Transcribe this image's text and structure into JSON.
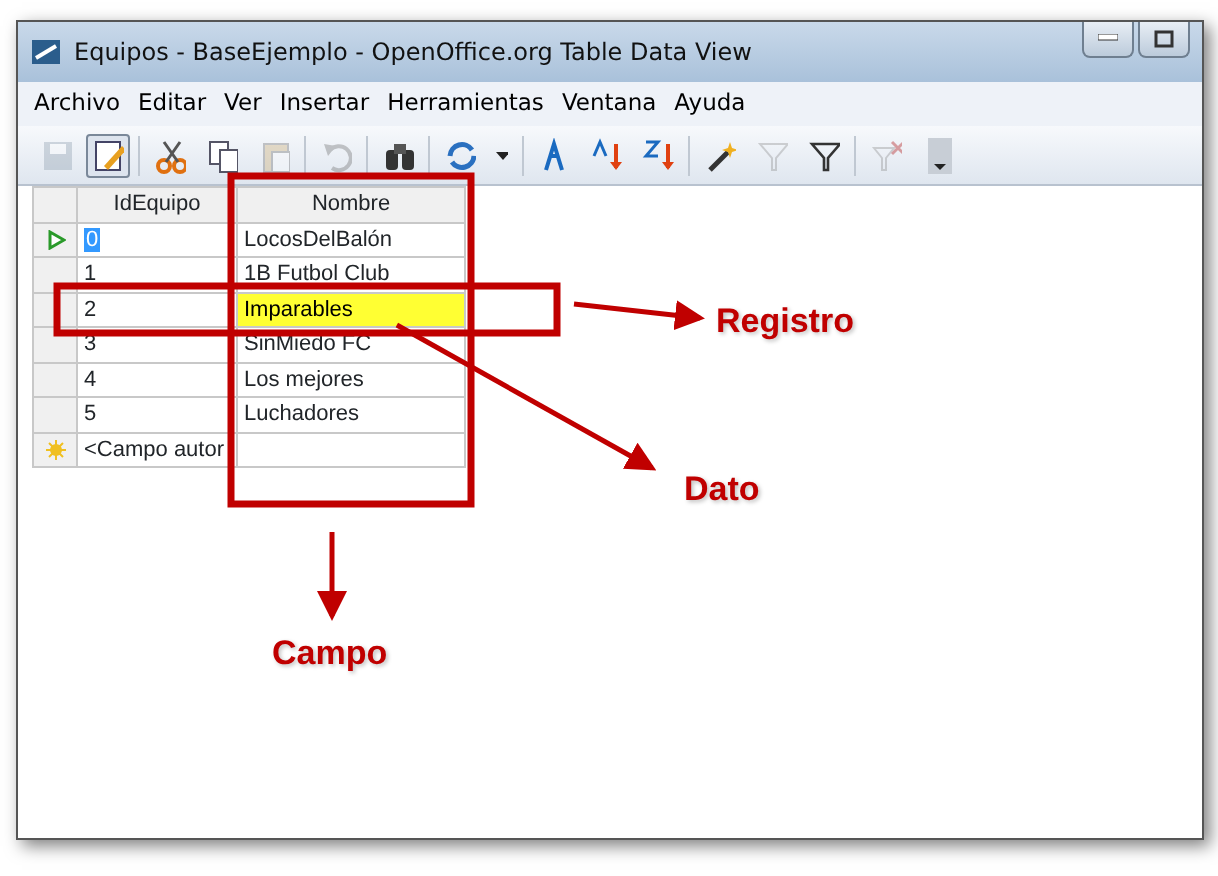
{
  "window": {
    "title": "Equipos - BaseEjemplo - OpenOffice.org Table Data View"
  },
  "menu": [
    "Archivo",
    "Editar",
    "Ver",
    "Insertar",
    "Herramientas",
    "Ventana",
    "Ayuda"
  ],
  "toolbar": [
    {
      "kind": "save",
      "disabled": true
    },
    {
      "kind": "edit",
      "disabled": false,
      "pressed": true
    },
    {
      "kind": "sep"
    },
    {
      "kind": "cut",
      "disabled": false
    },
    {
      "kind": "copy",
      "disabled": false
    },
    {
      "kind": "paste",
      "disabled": true
    },
    {
      "kind": "sep"
    },
    {
      "kind": "undo",
      "disabled": true
    },
    {
      "kind": "sep"
    },
    {
      "kind": "find",
      "disabled": false
    },
    {
      "kind": "sep"
    },
    {
      "kind": "refresh",
      "disabled": false
    },
    {
      "kind": "dropdown",
      "disabled": false
    },
    {
      "kind": "sep"
    },
    {
      "kind": "sort-az",
      "disabled": false
    },
    {
      "kind": "sort-asc",
      "disabled": false
    },
    {
      "kind": "sort-desc",
      "disabled": false
    },
    {
      "kind": "sep"
    },
    {
      "kind": "autofilter",
      "disabled": false
    },
    {
      "kind": "standard-filter",
      "disabled": true
    },
    {
      "kind": "filter",
      "disabled": false
    },
    {
      "kind": "sep"
    },
    {
      "kind": "remove-filter",
      "disabled": true
    },
    {
      "kind": "overflow",
      "disabled": false
    }
  ],
  "table": {
    "columns": [
      "IdEquipo",
      "Nombre"
    ],
    "rows": [
      {
        "cells": [
          "0",
          "LocosDelBalón"
        ],
        "selected": true
      },
      {
        "cells": [
          "1",
          "1B Futbol Club"
        ],
        "selected": false
      },
      {
        "cells": [
          "2",
          "Imparables"
        ],
        "selected": false,
        "highlighted": true
      },
      {
        "cells": [
          "3",
          "SinMiedo FC"
        ],
        "selected": false
      },
      {
        "cells": [
          "4",
          "Los mejores"
        ],
        "selected": false
      },
      {
        "cells": [
          "5",
          "Luchadores"
        ],
        "selected": false
      }
    ],
    "new_row": {
      "cells": [
        "<Campo autor"
      ]
    }
  },
  "annotations": [
    {
      "kind": "registro",
      "label": "Registro"
    },
    {
      "kind": "dato",
      "label": "Dato"
    },
    {
      "kind": "campo",
      "label": "Campo"
    }
  ]
}
